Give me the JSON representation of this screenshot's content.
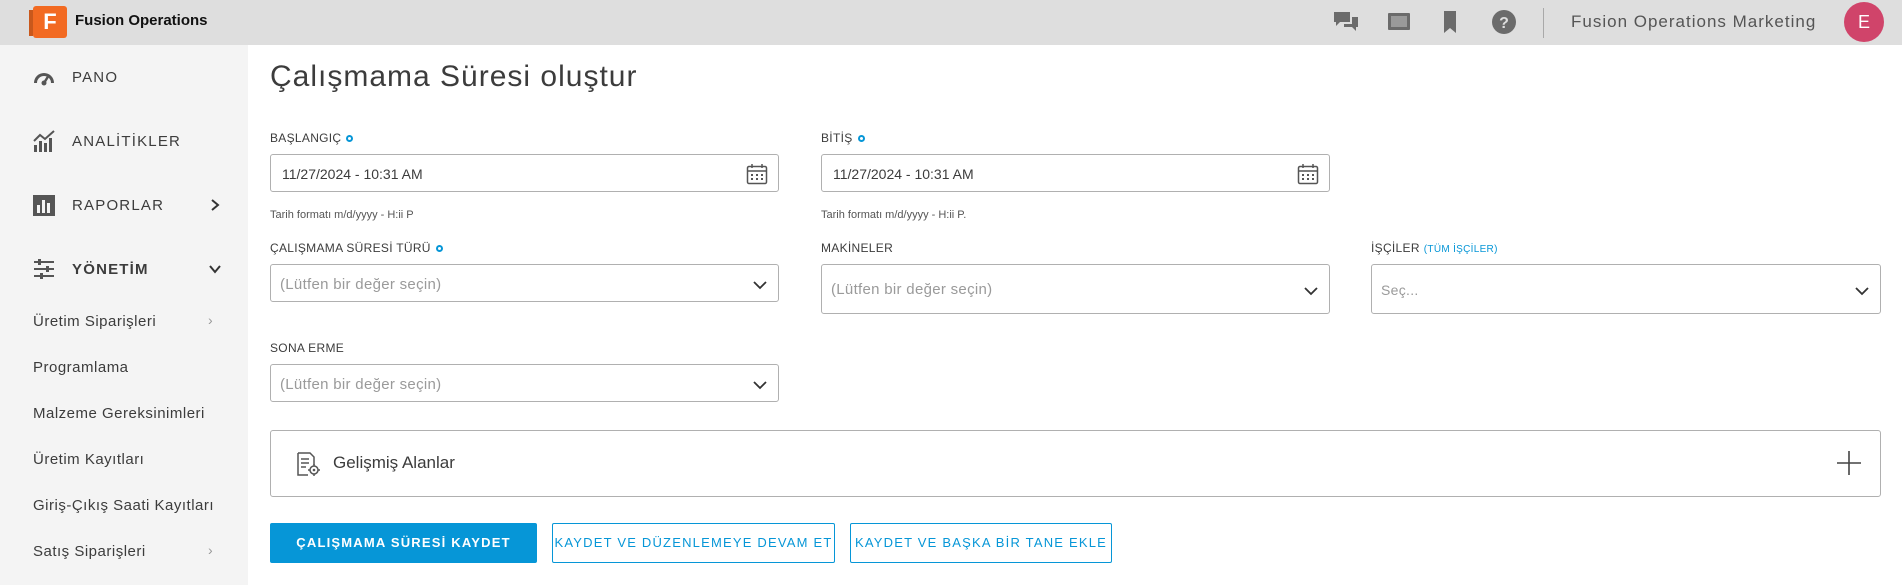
{
  "app": {
    "logo_letter": "F",
    "title": "Fusion Operations",
    "org_name": "Fusion Operations Marketing",
    "avatar_initial": "E",
    "top_icons": [
      "chat-icon",
      "screen-icon",
      "bookmark-icon",
      "help-icon"
    ]
  },
  "sidebar": {
    "items": [
      {
        "label": "PANO",
        "icon": "dashboard-icon"
      },
      {
        "label": "ANALİTİKLER",
        "icon": "analytics-icon"
      },
      {
        "label": "RAPORLAR",
        "icon": "reports-icon",
        "chevron": "›"
      },
      {
        "label": "YÖNETİM",
        "icon": "sliders-icon",
        "chevron": "⌄"
      }
    ],
    "sub_items": [
      {
        "label": "Üretim Siparişleri",
        "chevron": "›"
      },
      {
        "label": "Programlama"
      },
      {
        "label": "Malzeme Gereksinimleri"
      },
      {
        "label": "Üretim Kayıtları"
      },
      {
        "label": "Giriş-Çıkış Saati Kayıtları"
      },
      {
        "label": "Satış Siparişleri",
        "chevron": "›"
      }
    ]
  },
  "form": {
    "title": "Çalışmama Süresi oluştur",
    "start": {
      "label": "BAŞLANGIÇ",
      "value": "11/27/2024 - 10:31 AM",
      "hint": "Tarih formatı m/d/yyyy - H:ii P"
    },
    "end": {
      "label": "BİTİŞ",
      "value": "11/27/2024 - 10:31 AM",
      "hint": "Tarih formatı m/d/yyyy - H:ii P."
    },
    "downtime_type": {
      "label": "ÇALIŞMAMA SÜRESİ TÜRÜ",
      "placeholder": "(Lütfen bir değer seçin)"
    },
    "machines": {
      "label": "MAKİNELER",
      "placeholder": "(Lütfen bir değer seçin)"
    },
    "workers": {
      "label": "İŞÇİLER",
      "link": "(TÜM İŞÇİLER)",
      "placeholder": "Seç..."
    },
    "expiry": {
      "label": "SONA ERME",
      "placeholder": "(Lütfen bir değer seçin)"
    },
    "advanced": {
      "label": "Gelişmiş Alanlar"
    }
  },
  "actions": {
    "save": "ÇALIŞMAMA SÜRESİ KAYDET",
    "save_continue": "KAYDET VE DÜZENLEMEYE DEVAM ET",
    "save_add": "KAYDET VE BAŞKA BİR TANE EKLE"
  },
  "colors": {
    "accent": "#0696d7",
    "logo": "#f26a22",
    "avatar": "#d0446a"
  }
}
